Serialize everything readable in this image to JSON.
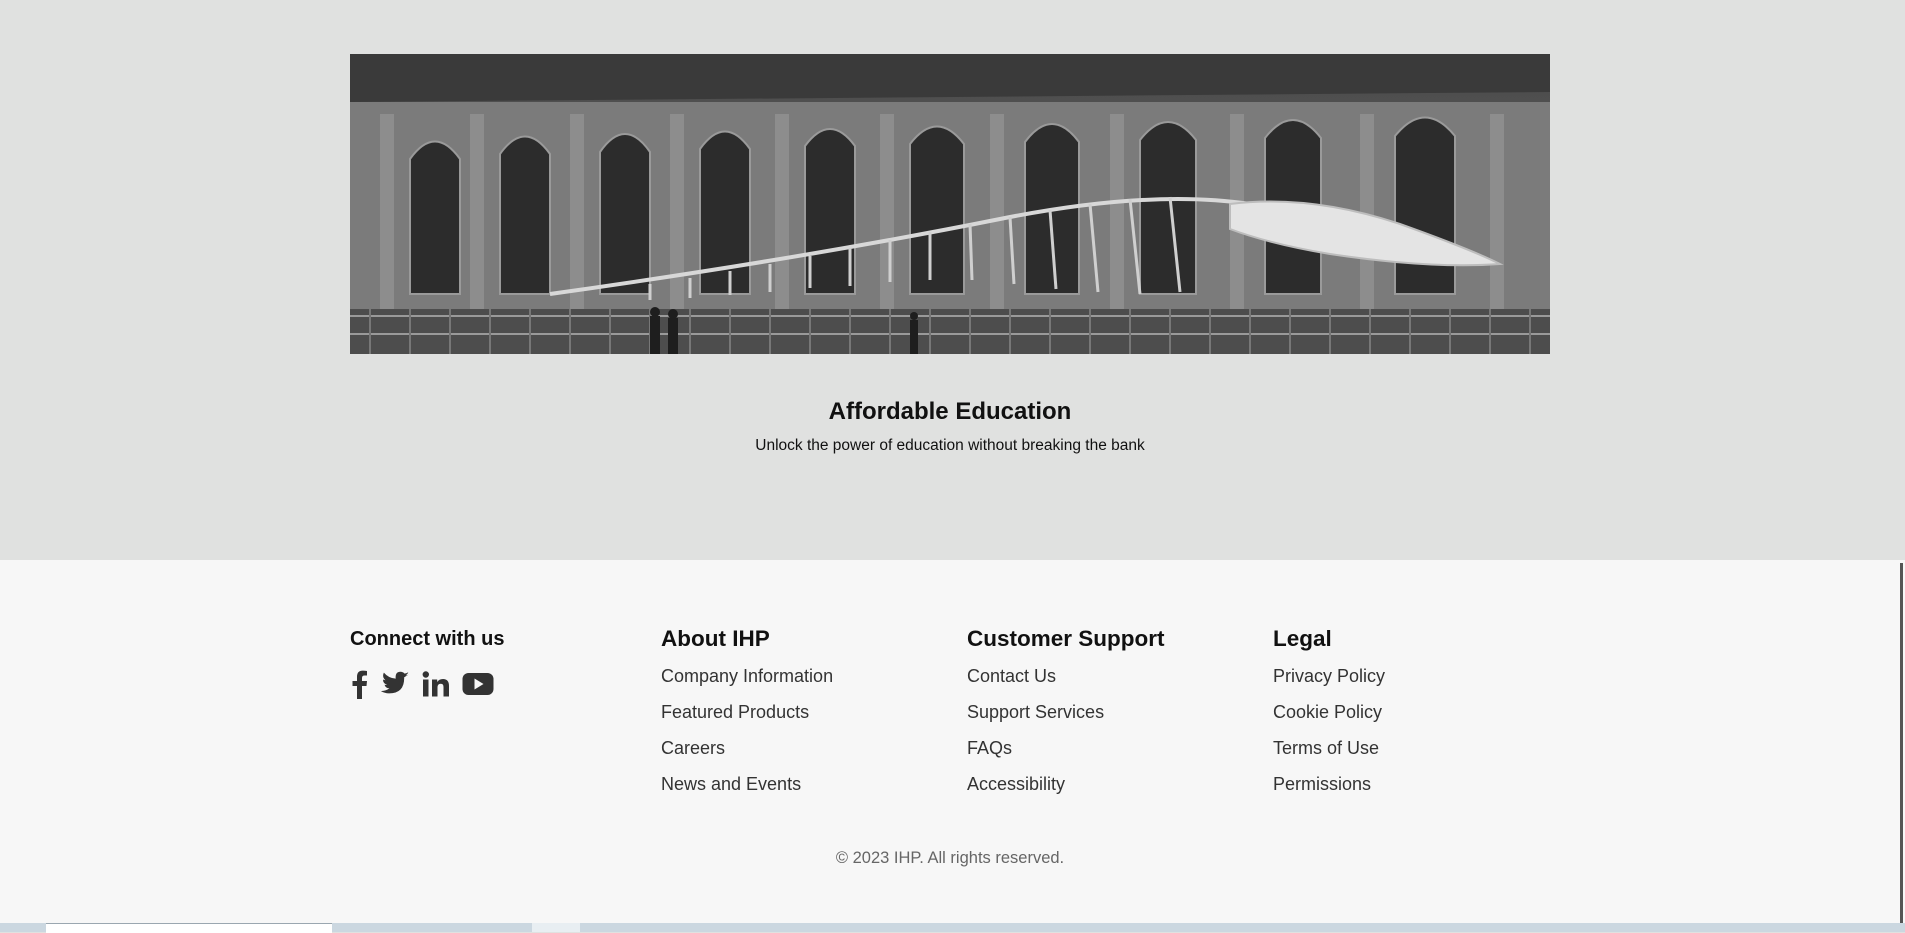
{
  "hero": {
    "title": "Affordable Education",
    "subtitle": "Unlock the power of education without breaking the bank",
    "image": "whale-skeleton-museum-photo"
  },
  "footer": {
    "connect": {
      "title": "Connect with us",
      "icons": [
        "facebook-icon",
        "twitter-icon",
        "linkedin-icon",
        "youtube-icon"
      ]
    },
    "about": {
      "title": "About IHP",
      "links": [
        "Company Information",
        "Featured Products",
        "Careers",
        "News and Events"
      ]
    },
    "support": {
      "title": "Customer Support",
      "links": [
        "Contact Us",
        "Support Services",
        "FAQs",
        "Accessibility"
      ]
    },
    "legal": {
      "title": "Legal",
      "links": [
        "Privacy Policy",
        "Cookie Policy",
        "Terms of Use",
        "Permissions"
      ]
    },
    "copyright": "© 2023 IHP. All rights reserved."
  },
  "colors": {
    "hero_bg": "#e0e1e0",
    "footer_bg": "#f7f7f7",
    "text_dark": "#111111",
    "link": "#333333"
  }
}
